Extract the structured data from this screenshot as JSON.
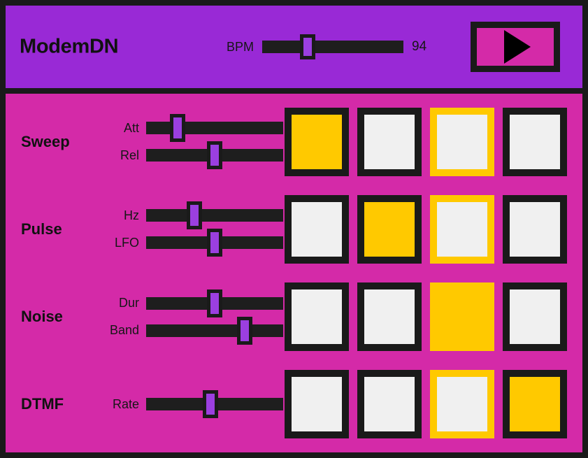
{
  "app": {
    "title": "ModemDN",
    "colors": {
      "frame": "#1a1a1a",
      "header_bg": "#9929d6",
      "body_bg": "#d42aa8",
      "accent_yellow": "#ffc900",
      "step_inactive": "#f0f0f0",
      "thumb_purple": "#9b3fe0"
    }
  },
  "transport": {
    "bpm_label": "BPM",
    "bpm_value": "94",
    "bpm_percent": 32,
    "play_icon": "play-triangle-icon"
  },
  "tracks": [
    {
      "name": "Sweep",
      "controls": [
        {
          "label": "Att",
          "percent": 23
        },
        {
          "label": "Rel",
          "percent": 50
        }
      ],
      "steps": [
        {
          "active": true,
          "playhead": false
        },
        {
          "active": false,
          "playhead": false
        },
        {
          "active": false,
          "playhead": true
        },
        {
          "active": false,
          "playhead": false
        }
      ]
    },
    {
      "name": "Pulse",
      "controls": [
        {
          "label": "Hz",
          "percent": 35
        },
        {
          "label": "LFO",
          "percent": 50
        }
      ],
      "steps": [
        {
          "active": false,
          "playhead": false
        },
        {
          "active": true,
          "playhead": false
        },
        {
          "active": false,
          "playhead": true
        },
        {
          "active": false,
          "playhead": false
        }
      ]
    },
    {
      "name": "Noise",
      "controls": [
        {
          "label": "Dur",
          "percent": 50
        },
        {
          "label": "Band",
          "percent": 72
        }
      ],
      "steps": [
        {
          "active": false,
          "playhead": false
        },
        {
          "active": false,
          "playhead": false
        },
        {
          "active": true,
          "playhead": true
        },
        {
          "active": false,
          "playhead": false
        }
      ]
    },
    {
      "name": "DTMF",
      "controls": [
        {
          "label": "Rate",
          "percent": 47
        }
      ],
      "steps": [
        {
          "active": false,
          "playhead": false
        },
        {
          "active": false,
          "playhead": false
        },
        {
          "active": false,
          "playhead": true
        },
        {
          "active": true,
          "playhead": false
        }
      ]
    }
  ]
}
